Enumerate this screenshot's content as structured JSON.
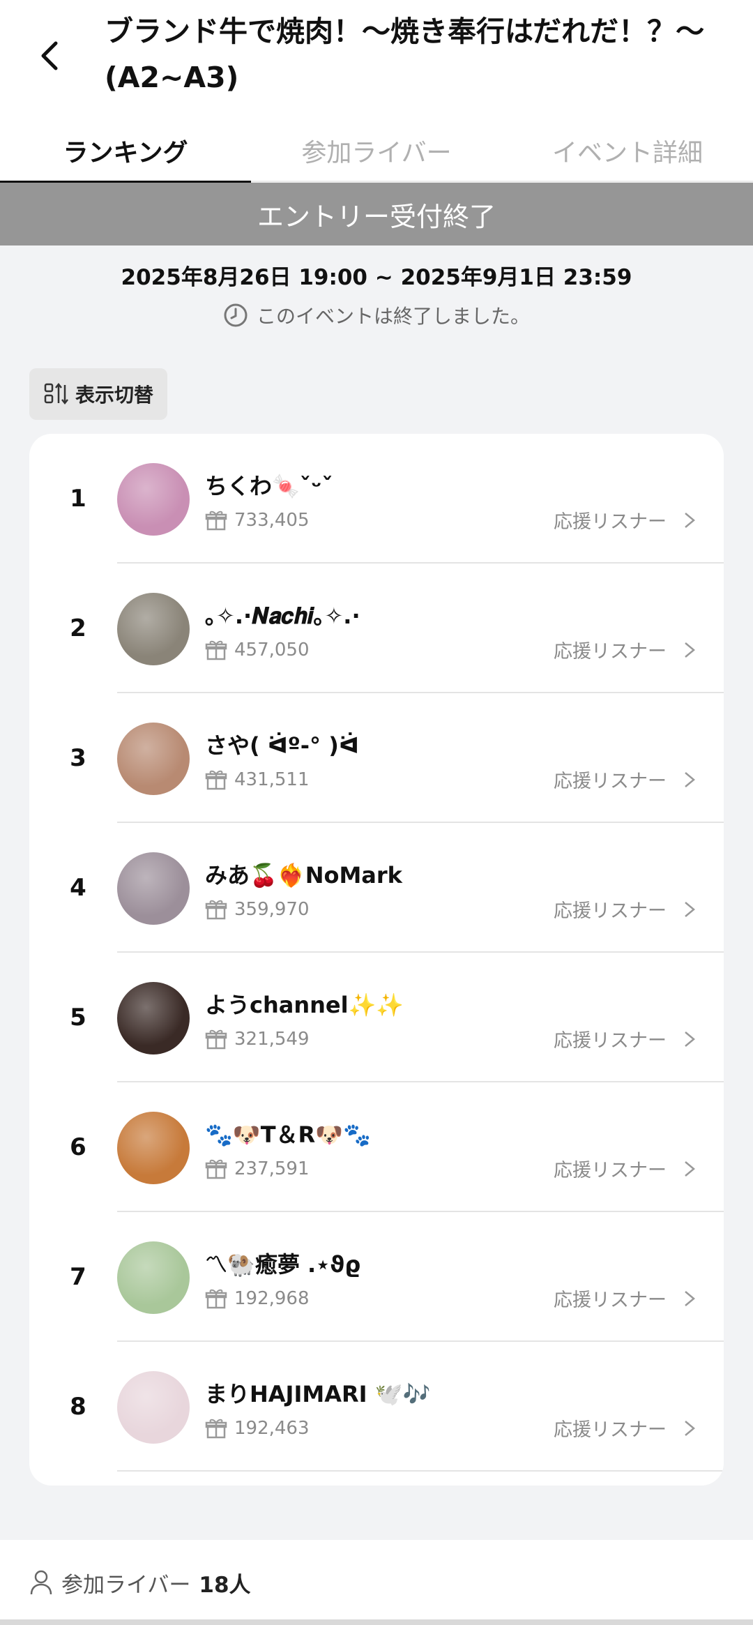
{
  "header": {
    "title": "ブランド牛で焼肉！〜焼き奉行はだれだ！？〜 (A2~A3)"
  },
  "tabs": [
    {
      "label": "ランキング",
      "active": true
    },
    {
      "label": "参加ライバー",
      "active": false
    },
    {
      "label": "イベント詳細",
      "active": false
    }
  ],
  "banner": {
    "text": "エントリー受付終了"
  },
  "event": {
    "period": "2025年8月26日 19:00 ~ 2025年9月1日 23:59",
    "status": "このイベントは終了しました。"
  },
  "toggle": {
    "label": "表示切替"
  },
  "ranking": [
    {
      "rank": "1",
      "name": "ちくわ🍬ˇᵕˇ",
      "points": "733,405",
      "supporters": "応援リスナー",
      "avatar_color": "#c98fb4"
    },
    {
      "rank": "2",
      "name": "｡✧.·𝑵𝒂𝒄𝒉𝒊｡✧.·",
      "points": "457,050",
      "supporters": "応援リスナー",
      "avatar_color": "#8a8478"
    },
    {
      "rank": "3",
      "name": "さや( ᐛº-° )ᐛ",
      "points": "431,511",
      "supporters": "応援リスナー",
      "avatar_color": "#b88a72"
    },
    {
      "rank": "4",
      "name": "みあ🍒❤️‍🔥NoMark",
      "points": "359,970",
      "supporters": "応援リスナー",
      "avatar_color": "#9c8f9a"
    },
    {
      "rank": "5",
      "name": "ようchannel✨✨",
      "points": "321,549",
      "supporters": "応援リスナー",
      "avatar_color": "#3a2a26"
    },
    {
      "rank": "6",
      "name": "🐾🐶T＆R🐶🐾",
      "points": "237,591",
      "supporters": "応援リスナー",
      "avatar_color": "#c77a3a"
    },
    {
      "rank": "7",
      "name": "〽︎🐏癒夢 .⋆ϑϱ",
      "points": "192,968",
      "supporters": "応援リスナー",
      "avatar_color": "#a9c79a"
    },
    {
      "rank": "8",
      "name": "まりHAJIMARI 🕊️🎶",
      "points": "192,463",
      "supporters": "応援リスナー",
      "avatar_color": "#e8d6dc"
    }
  ],
  "footer": {
    "label": "参加ライバー",
    "count": "18人"
  },
  "colors": {
    "banner": "#969696",
    "accent": "#111111",
    "muted": "#8a8a8a"
  },
  "icons": {
    "back": "chevron-left-icon",
    "clock": "clock-icon",
    "toggle": "sort-toggle-icon",
    "gift": "gift-icon",
    "chevron": "chevron-right-icon",
    "user": "user-icon"
  }
}
